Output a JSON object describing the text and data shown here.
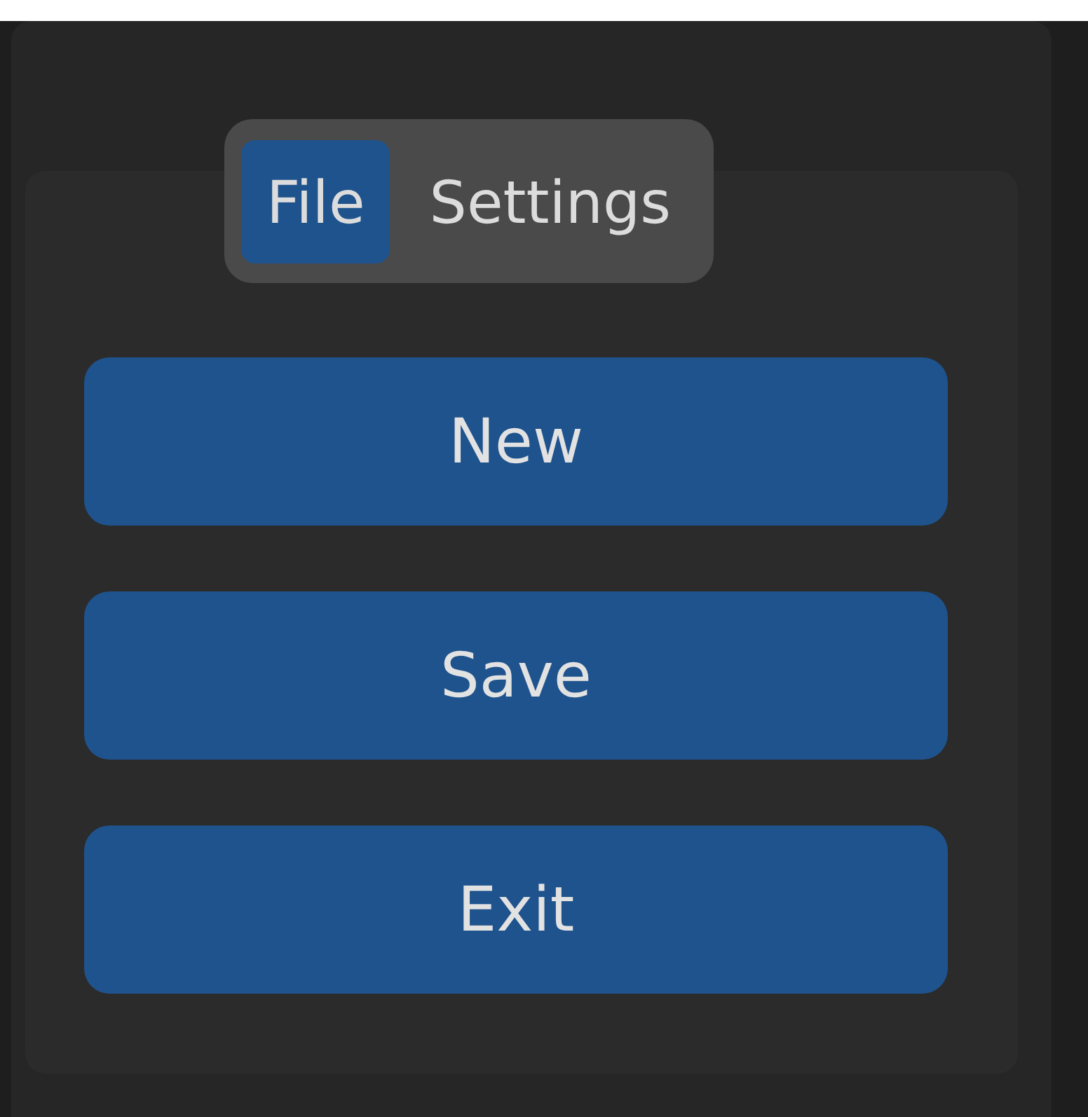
{
  "tabs": [
    {
      "label": "File",
      "selected": true
    },
    {
      "label": "Settings",
      "selected": false
    }
  ],
  "buttons": [
    "New",
    "Save",
    "Exit"
  ]
}
